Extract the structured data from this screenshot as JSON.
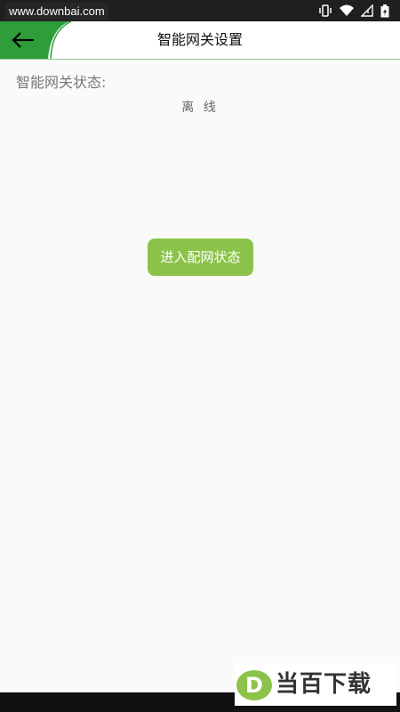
{
  "status_bar": {
    "watermark_url": "www.downbai.com",
    "icons": [
      "vibrate-icon",
      "wifi-icon",
      "signal-icon",
      "battery-icon"
    ]
  },
  "header": {
    "title": "智能网关设置",
    "back_icon": "arrow-left-icon",
    "accent_color": "#2e9e3a"
  },
  "gateway": {
    "status_label": "智能网关状态:",
    "status_value": "离 线"
  },
  "actions": {
    "config_button_label": "进入配网状态",
    "config_button_color": "#8bc34a"
  },
  "brand_watermark": {
    "logo_letter": "D",
    "text": "当百下载"
  }
}
